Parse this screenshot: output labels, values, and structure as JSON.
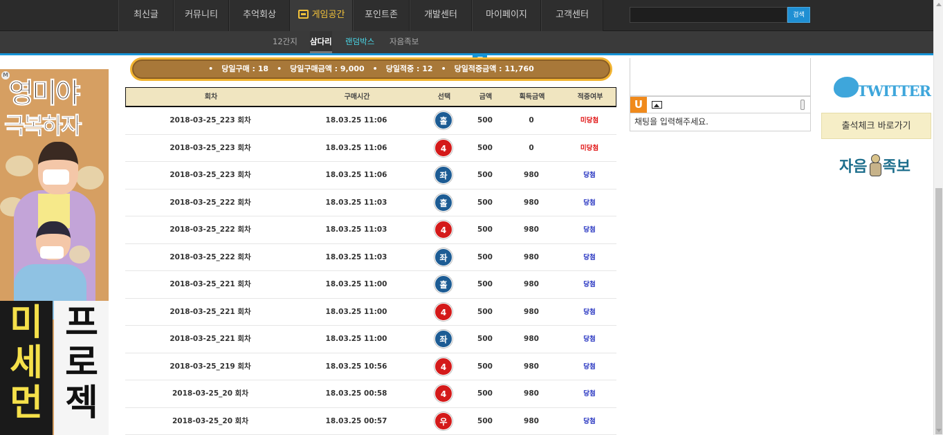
{
  "nav": {
    "menu": [
      {
        "label": "최신글",
        "active": false
      },
      {
        "label": "커뮤니티",
        "active": false
      },
      {
        "label": "추억회상",
        "active": false
      },
      {
        "label": "게임공간",
        "active": true
      },
      {
        "label": "포인트존",
        "active": false
      },
      {
        "label": "개발센터",
        "active": false
      },
      {
        "label": "마이페이지",
        "active": false
      },
      {
        "label": "고객센터",
        "active": false
      }
    ],
    "search_button": "검색",
    "search_value": ""
  },
  "subnav": {
    "items": [
      {
        "label": "12간지",
        "state": "normal"
      },
      {
        "label": "삼다리",
        "state": "current"
      },
      {
        "label": "랜덤박스",
        "state": "highlight"
      },
      {
        "label": "자음족보",
        "state": "normal"
      }
    ]
  },
  "ad": {
    "mark": "M",
    "headline1": "영미야",
    "headline2": "극복하자",
    "vertical1": "미세먼",
    "vertical2": "프로젝"
  },
  "summary": {
    "items": [
      "당일구매 : 18",
      "당일구매금액 : 9,000",
      "당일적중 : 12",
      "당일적중금액 : 11,760"
    ],
    "bullet": "•"
  },
  "table": {
    "headers": [
      "회차",
      "구매시간",
      "선택",
      "금액",
      "획득금액",
      "적중여부"
    ],
    "rows": [
      {
        "round": "2018-03-25_223 회차",
        "time": "18.03.25 11:06",
        "pick": "홀",
        "pick_color": "blue",
        "amount": "500",
        "won": "0",
        "result": "미당첨",
        "result_type": "lose"
      },
      {
        "round": "2018-03-25_223 회차",
        "time": "18.03.25 11:06",
        "pick": "4",
        "pick_color": "red",
        "amount": "500",
        "won": "0",
        "result": "미당첨",
        "result_type": "lose"
      },
      {
        "round": "2018-03-25_223 회차",
        "time": "18.03.25 11:06",
        "pick": "좌",
        "pick_color": "blue",
        "amount": "500",
        "won": "980",
        "result": "당첨",
        "result_type": "win"
      },
      {
        "round": "2018-03-25_222 회차",
        "time": "18.03.25 11:03",
        "pick": "홀",
        "pick_color": "blue",
        "amount": "500",
        "won": "980",
        "result": "당첨",
        "result_type": "win"
      },
      {
        "round": "2018-03-25_222 회차",
        "time": "18.03.25 11:03",
        "pick": "4",
        "pick_color": "red",
        "amount": "500",
        "won": "980",
        "result": "당첨",
        "result_type": "win"
      },
      {
        "round": "2018-03-25_222 회차",
        "time": "18.03.25 11:03",
        "pick": "좌",
        "pick_color": "blue",
        "amount": "500",
        "won": "980",
        "result": "당첨",
        "result_type": "win"
      },
      {
        "round": "2018-03-25_221 회차",
        "time": "18.03.25 11:00",
        "pick": "홀",
        "pick_color": "blue",
        "amount": "500",
        "won": "980",
        "result": "당첨",
        "result_type": "win"
      },
      {
        "round": "2018-03-25_221 회차",
        "time": "18.03.25 11:00",
        "pick": "4",
        "pick_color": "red",
        "amount": "500",
        "won": "980",
        "result": "당첨",
        "result_type": "win"
      },
      {
        "round": "2018-03-25_221 회차",
        "time": "18.03.25 11:00",
        "pick": "좌",
        "pick_color": "blue",
        "amount": "500",
        "won": "980",
        "result": "당첨",
        "result_type": "win"
      },
      {
        "round": "2018-03-25_219 회차",
        "time": "18.03.25 10:56",
        "pick": "4",
        "pick_color": "red",
        "amount": "500",
        "won": "980",
        "result": "당첨",
        "result_type": "win"
      },
      {
        "round": "2018-03-25_20 회차",
        "time": "18.03.25 00:58",
        "pick": "4",
        "pick_color": "red",
        "amount": "500",
        "won": "980",
        "result": "당첨",
        "result_type": "win"
      },
      {
        "round": "2018-03-25_20 회차",
        "time": "18.03.25 00:57",
        "pick": "우",
        "pick_color": "red",
        "amount": "500",
        "won": "980",
        "result": "당첨",
        "result_type": "win"
      }
    ]
  },
  "chat": {
    "logo": "U",
    "placeholder": "채팅을 입력해주세요."
  },
  "sidebar": {
    "twitter_label": "TWITTER",
    "attendance_label": "출석체크 바로가기",
    "jokbo_left": "자음",
    "jokbo_right": "족보"
  },
  "colors": {
    "nav_bg": "#2b2b2b",
    "accent_blue": "#1693d6",
    "active_menu": "#f3c23a",
    "win": "#2432c0",
    "lose": "#e01010"
  }
}
